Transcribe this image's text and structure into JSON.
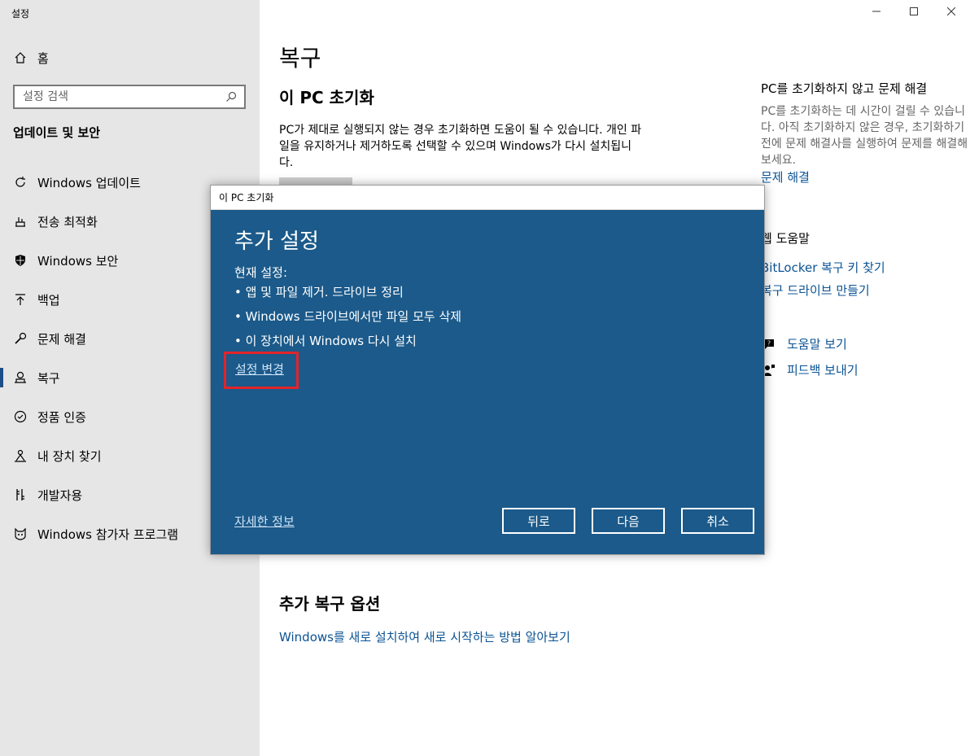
{
  "app": {
    "title": "설정"
  },
  "sidebar": {
    "home_label": "홈",
    "search_placeholder": "설정 검색",
    "section_title": "업데이트 및 보안",
    "items": [
      {
        "label": "Windows 업데이트",
        "icon": "refresh-icon"
      },
      {
        "label": "전송 최적화",
        "icon": "delivery-icon"
      },
      {
        "label": "Windows 보안",
        "icon": "shield-icon"
      },
      {
        "label": "백업",
        "icon": "backup-arrow-icon"
      },
      {
        "label": "문제 해결",
        "icon": "wrench-icon"
      },
      {
        "label": "복구",
        "icon": "recovery-icon",
        "selected": true
      },
      {
        "label": "정품 인증",
        "icon": "check-circle-icon"
      },
      {
        "label": "내 장치 찾기",
        "icon": "person-pin-icon"
      },
      {
        "label": "개발자용",
        "icon": "developer-icon"
      },
      {
        "label": "Windows 참가자 프로그램",
        "icon": "insider-cat-icon"
      }
    ]
  },
  "main": {
    "title": "복구",
    "reset_title": "이 PC 초기화",
    "reset_desc": "PC가 제대로 실행되지 않는 경우 초기화하면 도움이 될 수 있습니다. 개인 파일을 유지하거나 제거하도록 선택할 수 있으며 Windows가 다시 설치됩니다.",
    "more_title": "추가 복구 옵션",
    "more_link": "Windows를 새로 설치하여 새로 시작하는 방법 알아보기"
  },
  "right_panel": {
    "troubleshoot_title": "PC를 초기화하지 않고 문제 해결",
    "troubleshoot_desc": "PC를 초기화하는 데 시간이 걸릴 수 있습니다. 아직 초기화하지 않은 경우, 초기화하기 전에 문제 해결사를 실행하여 문제를 해결해 보세요.",
    "troubleshoot_link": "문제 해결",
    "web_help_title": "웹 도움말",
    "web_help_links": [
      "BitLocker 복구 키 찾기",
      "복구 드라이브 만들기"
    ],
    "get_help": "도움말 보기",
    "feedback": "피드백 보내기"
  },
  "dialog": {
    "window_title": "이 PC 초기화",
    "heading": "추가 설정",
    "current_label": "현재 설정:",
    "settings": [
      "•  앱 및 파일 제거. 드라이브 정리",
      "•  Windows 드라이브에서만 파일 모두 삭제",
      "• 이 장치에서 Windows 다시 설치"
    ],
    "change_link": "설정 변경",
    "learn_more": "자세한 정보",
    "back": "뒤로",
    "next": "다음",
    "cancel": "취소"
  },
  "colors": {
    "dialog_bg": "#1b5a8a",
    "sidebar_bg": "#e6e6e6",
    "link": "#0b5394",
    "highlight": "#e2242b"
  }
}
